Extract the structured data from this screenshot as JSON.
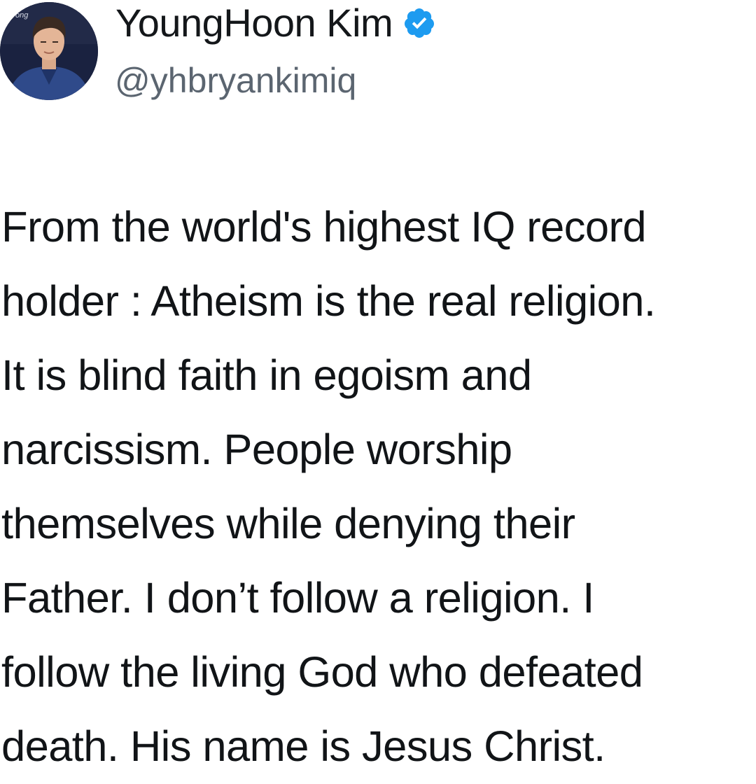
{
  "author": {
    "display_name": "YoungHoon Kim",
    "handle": "@yhbryankimiq",
    "verified": true,
    "avatar_icon": "profile-photo",
    "badge_icon": "verified-badge-icon",
    "badge_color": "#1d9bf0"
  },
  "tweet": {
    "lines": [
      "From the world's highest IQ record",
      "holder : Atheism is the real religion.",
      "It is blind faith in egoism and",
      "narcissism. People worship",
      "themselves while denying their",
      "Father. I don’t follow a religion. I",
      "follow the living God who defeated",
      "death. His name is Jesus Christ."
    ]
  }
}
